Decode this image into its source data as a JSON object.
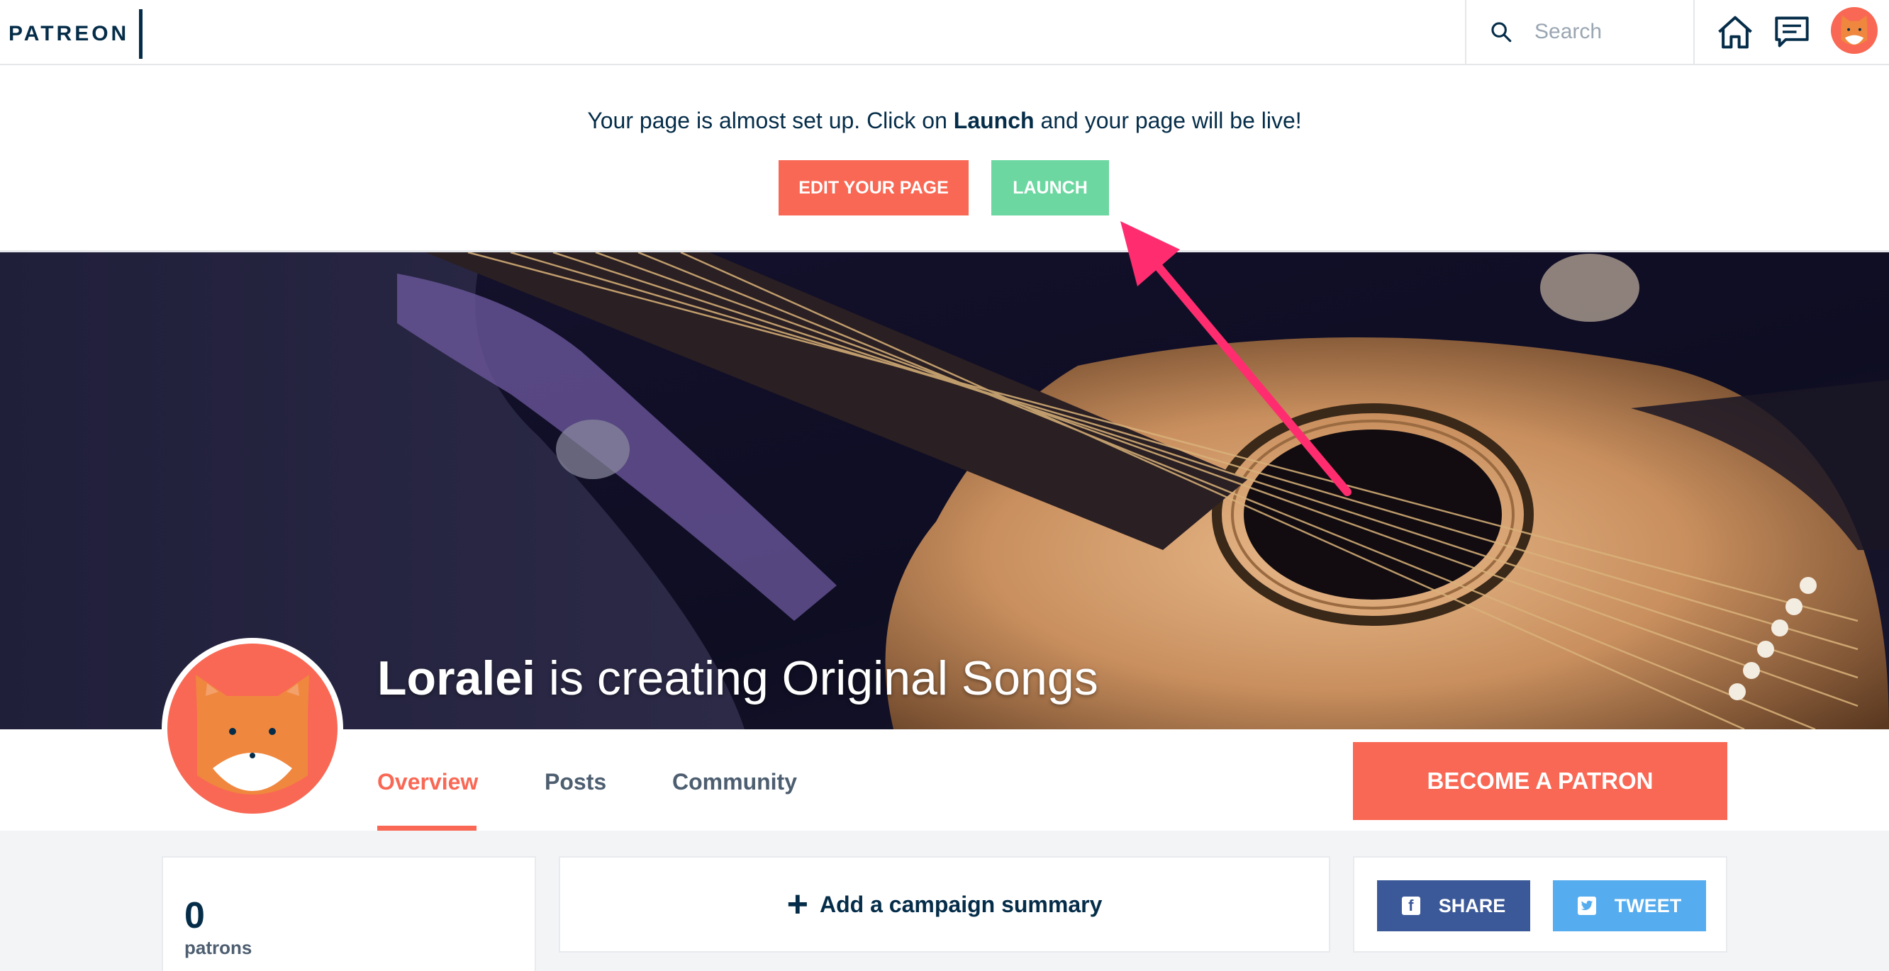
{
  "nav": {
    "logo": "PATREON",
    "search_placeholder": "Search",
    "icons": [
      "search-icon",
      "home-icon",
      "messages-icon",
      "user-avatar"
    ]
  },
  "setup": {
    "message_before": "Your page is almost set up. Click on ",
    "message_bold": "Launch",
    "message_after": " and your page will be live!",
    "edit_label": "EDIT YOUR PAGE",
    "launch_label": "LAUNCH"
  },
  "hero": {
    "creator_name": "Loralei",
    "creating_text": " is creating Original Songs"
  },
  "tabs": [
    {
      "label": "Overview",
      "active": true
    },
    {
      "label": "Posts",
      "active": false
    },
    {
      "label": "Community",
      "active": false
    }
  ],
  "cta": {
    "become_patron": "BECOME A PATRON"
  },
  "stats": {
    "patron_count": "0",
    "patron_label": "patrons"
  },
  "summary": {
    "add_label": "Add a campaign summary"
  },
  "share": {
    "facebook_label": "SHARE",
    "twitter_label": "TWEET"
  },
  "colors": {
    "brand_coral": "#f96854",
    "navy": "#052d49",
    "launch_green": "#6cd7a0",
    "facebook_blue": "#3b5998",
    "twitter_blue": "#55acee",
    "annotation_arrow": "#ff2d6f"
  }
}
